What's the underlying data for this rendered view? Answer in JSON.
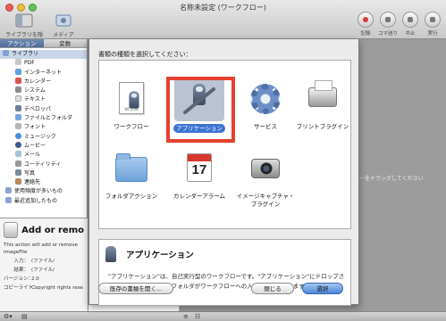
{
  "window": {
    "title": "名称未設定 (ワークフロー)",
    "toolbar_left": [
      {
        "label": "ライブラリを隠す"
      },
      {
        "label": "メディア"
      }
    ],
    "toolbar_right": [
      {
        "label": "記録"
      },
      {
        "label": "コマ送り"
      },
      {
        "label": "中止"
      },
      {
        "label": "実行"
      }
    ]
  },
  "left_pane": {
    "tabs": [
      "アクション",
      "変数"
    ],
    "library_root": "ライブラリ",
    "library_items": [
      "PDF",
      "インターネット",
      "カレンダー",
      "システム",
      "テキスト",
      "デベロッパ",
      "ファイルとフォルダ",
      "フォント",
      "ミュージック",
      "ムービー",
      "メール",
      "ユーティリティ",
      "写真",
      "連絡先"
    ],
    "extra_items": [
      "使用頻度が多いもの",
      "最近追加したもの"
    ],
    "details": {
      "action_name": "Add or remo",
      "description": "This action will add or remove imageFile",
      "input_label": "入力：",
      "input_value": "(ファイル/",
      "result_label": "結果：",
      "result_value": "(ファイル/",
      "version_label": "バージョン：",
      "version_value": "2.0",
      "copyright_label": "コピーライト：",
      "copyright_value": "Copyright rights rese"
    }
  },
  "canvas": {
    "drag_hint": "ーをドラッグしてください"
  },
  "sheet": {
    "prompt": "書類の種類を選択してください：",
    "selected_index": 1,
    "types": [
      {
        "label": "ワークフロー",
        "icon": "workflow-document-icon"
      },
      {
        "label": "アプリケーション",
        "icon": "application-robot-icon"
      },
      {
        "label": "サービス",
        "icon": "service-gear-icon"
      },
      {
        "label": "プリントプラグイン",
        "icon": "printer-icon"
      },
      {
        "label": "フォルダアクション",
        "icon": "folder-icon"
      },
      {
        "label": "カレンダーアラーム",
        "icon": "calendar-icon",
        "date": "17"
      },
      {
        "label": "イメージキャプチャ・プラグイン",
        "icon": "camera-icon"
      }
    ],
    "description_title": "アプリケーション",
    "description_text": "\"アプリケーション\"は、自己実行型のワークフローです。\"アプリケーション\"にドロップされたすべてのファイルやフォルダがワークフローへの入力として使われます。",
    "open_existing_label": "既存の書類を開く...",
    "close_label": "閉じる",
    "choose_label": "選択"
  },
  "colors": {
    "selection_blue": "#3b74d2",
    "highlight_frame": "#e5412f"
  }
}
